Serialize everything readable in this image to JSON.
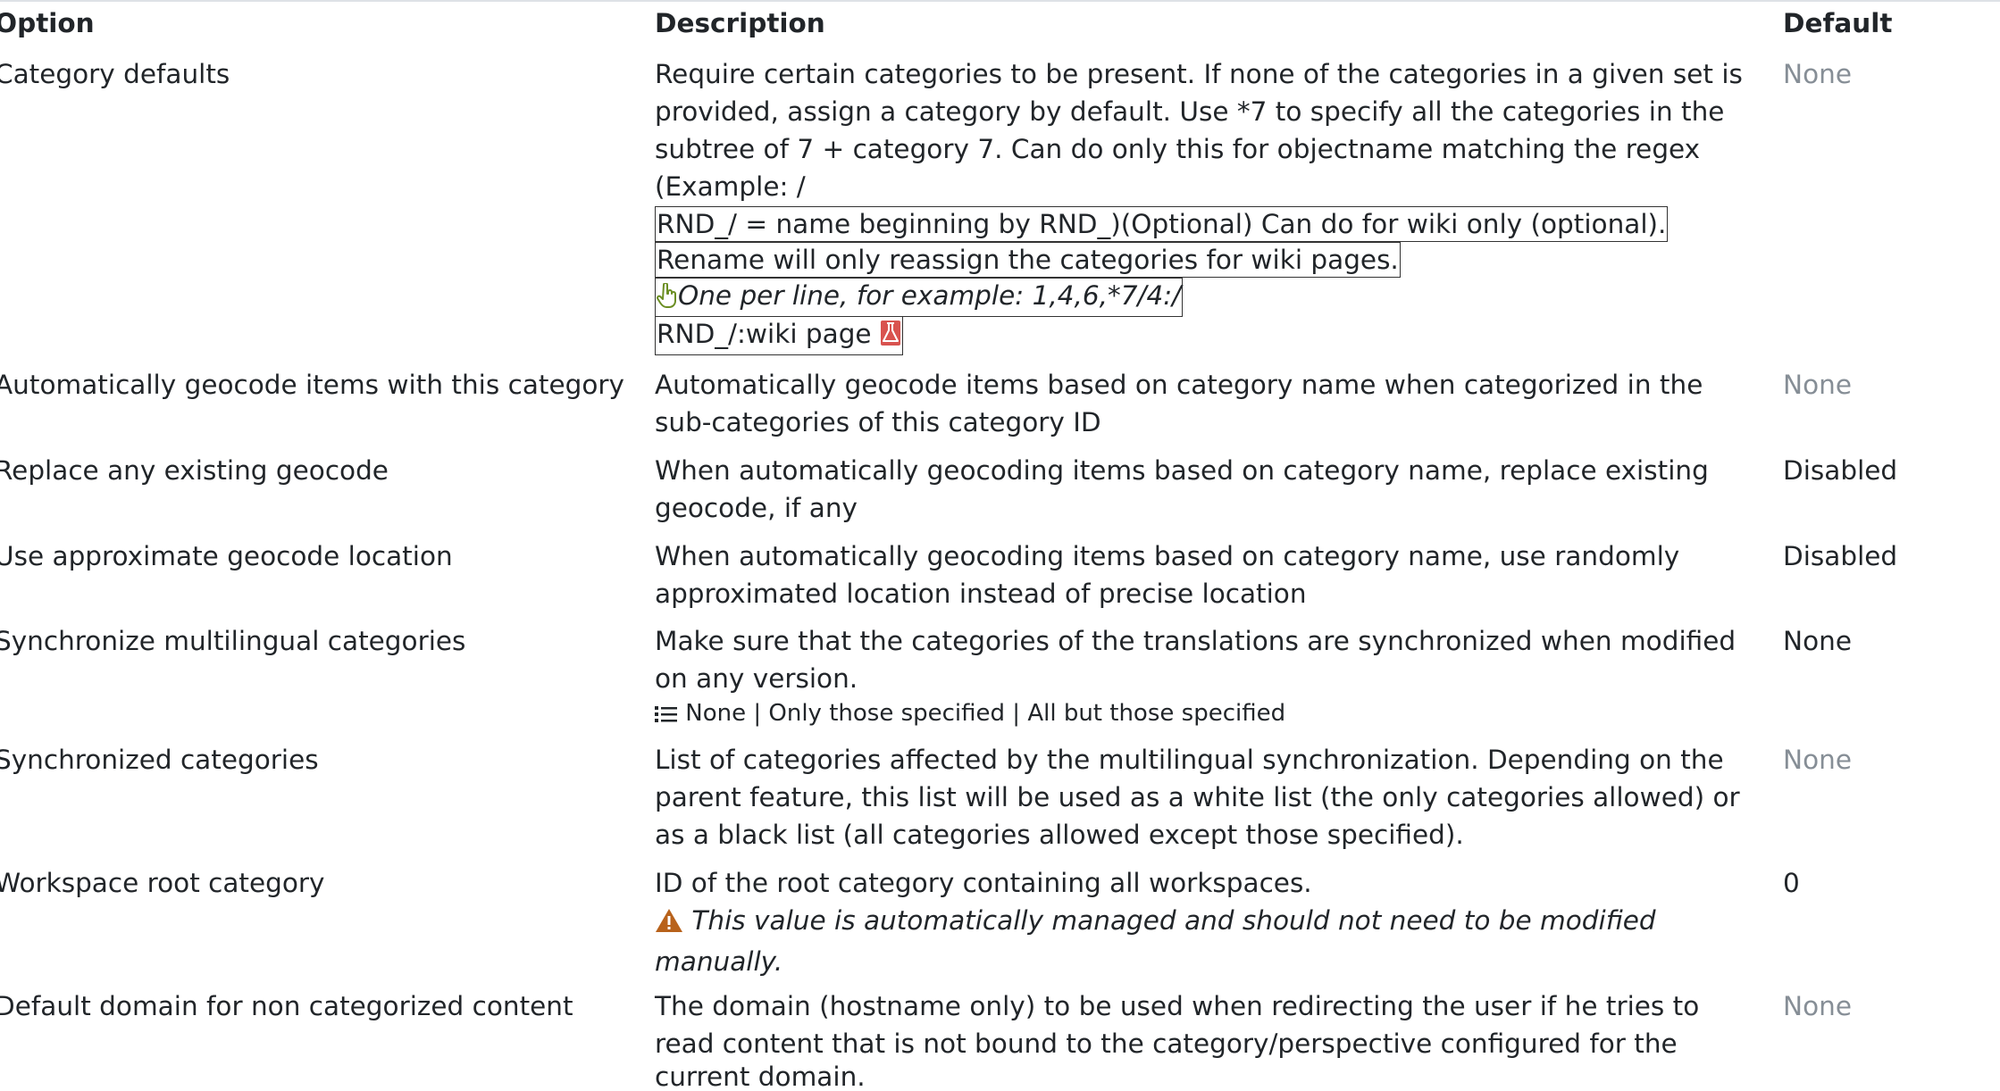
{
  "header": {
    "option": "Option",
    "description": "Description",
    "default": "Default"
  },
  "rows": [
    {
      "option": "Category defaults",
      "description_lines": [
        "Require certain categories to be present. If none of the categories in a given set is",
        "provided, assign a category by default. Use *7 to specify all the categories in the",
        "subtree of 7 + category 7. Can do only this for objectname matching the regex",
        "(Example: /"
      ],
      "boxed_lines": [
        "RND_/ = name beginning by RND_)(Optional) Can do for wiki only (optional).",
        "Rename will only reassign the categories for wiki pages."
      ],
      "example": "One per line, for example: 1,4,6,*7/4:/",
      "example_last": "RND_/:wiki page",
      "default": "None"
    },
    {
      "option": "Automatically geocode items with this category",
      "description_lines": [
        "Automatically geocode items based on category name when categorized in the",
        "sub-categories of this category ID"
      ],
      "default": "None"
    },
    {
      "option": "Replace any existing geocode",
      "description_lines": [
        "When automatically geocoding items based on category name, replace existing",
        "geocode, if any"
      ],
      "default": "Disabled"
    },
    {
      "option": "Use approximate geocode location",
      "description_lines": [
        "When automatically geocoding items based on category name, use randomly",
        "approximated location instead of precise location"
      ],
      "default": "Disabled"
    },
    {
      "option": "Synchronize multilingual categories",
      "description_lines": [
        "Make sure that the categories of the translations are synchronized when modified",
        "on any version."
      ],
      "options_list": "None | Only those specified | All but those specified",
      "default": "None"
    },
    {
      "option": "Synchronized categories",
      "description_lines": [
        "List of categories affected by the multilingual synchronization. Depending on the",
        "parent feature, this list will be used as a white list (the only categories allowed) or",
        "as a black list (all categories allowed except those specified)."
      ],
      "default": "None"
    },
    {
      "option": "Workspace root category",
      "description_lines": [
        "ID of the root category containing all workspaces."
      ],
      "warning_lines": [
        "This value is automatically managed and should not need to be modified",
        "manually."
      ],
      "default": "0"
    },
    {
      "option": "Default domain for non categorized content",
      "description_lines": [
        "The domain (hostname only) to be used when redirecting the user if he tries to",
        "read content that is not bound to the category/perspective configured for the",
        "current domain."
      ],
      "default": "None"
    }
  ],
  "colors": {
    "text": "#212529",
    "muted": "#868e96",
    "tip_icon": "#6b8e23",
    "experimental_icon": "#d9534f",
    "warning_icon": "#b8621b"
  },
  "icons": {
    "tip": "pointing-hand-icon",
    "experimental": "flask-icon",
    "list": "list-icon",
    "warning": "warning-triangle-icon"
  }
}
